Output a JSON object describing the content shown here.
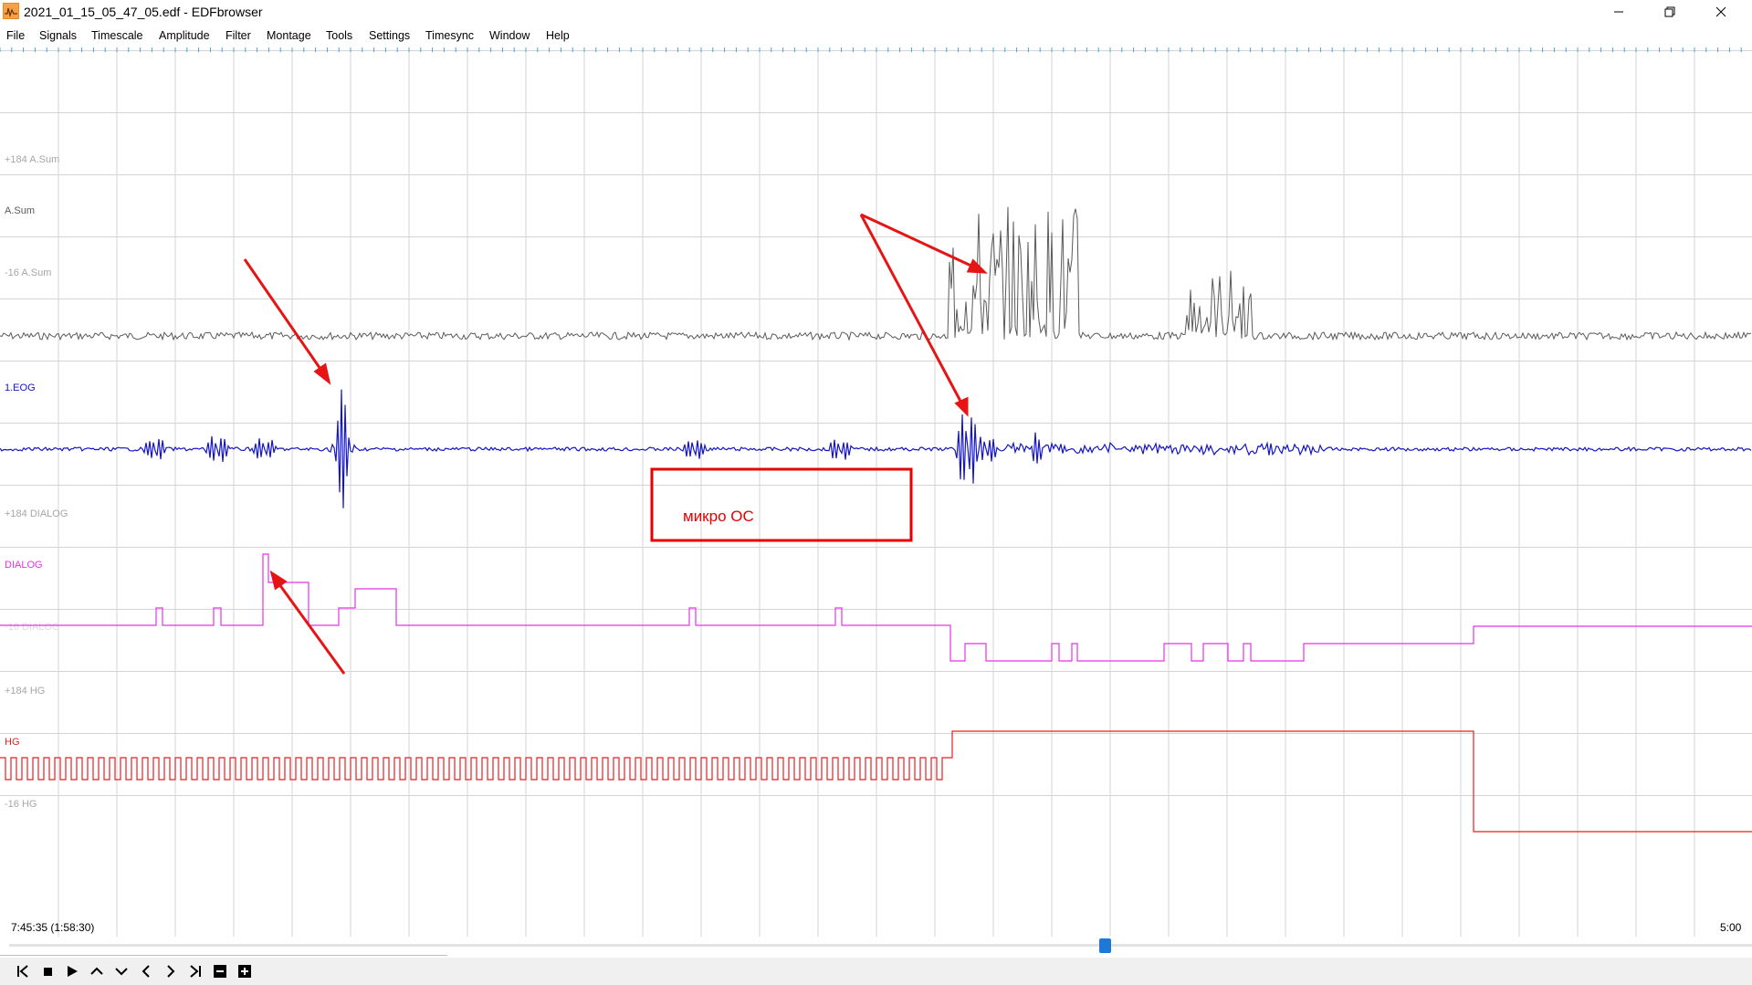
{
  "window": {
    "title": "2021_01_15_05_47_05.edf - EDFbrowser",
    "controls": [
      "minimize-icon",
      "restore-icon",
      "close-icon"
    ]
  },
  "menu": [
    {
      "label": "File",
      "key": "F"
    },
    {
      "label": "Signals",
      "key": "S"
    },
    {
      "label": "Timescale",
      "key": "T"
    },
    {
      "label": "Amplitude",
      "key": "A"
    },
    {
      "label": "Filter",
      "key": "F"
    },
    {
      "label": "Montage",
      "key": "M"
    },
    {
      "label": "Tools",
      "key": "o"
    },
    {
      "label": "Settings",
      "key": "S"
    },
    {
      "label": "Timesync",
      "key": "T"
    },
    {
      "label": "Window",
      "key": "W"
    },
    {
      "label": "Help",
      "key": "H"
    }
  ],
  "signals": [
    {
      "name": "A.Sum",
      "upper": "+184 A.Sum",
      "lower": "-16 A.Sum",
      "color": "#5a5a5a"
    },
    {
      "name": "1.EOG",
      "upper": "",
      "lower": "",
      "color": "#1414c8"
    },
    {
      "name": "DIALOG",
      "upper": "+184 DIALOG",
      "lower": "-16 DIALOG",
      "color": "#e632e6"
    },
    {
      "name": "HG",
      "upper": "+184 HG",
      "lower": "-16 HG",
      "color": "#e61e1e"
    }
  ],
  "annotation": {
    "label": "микро ОС",
    "color": "#e60000"
  },
  "timeline": {
    "start": "7:45:35 (1:58:30)",
    "end": "5:00",
    "scroll_position": 0.63
  },
  "toolbar": [
    "skip-start-icon",
    "stop-icon",
    "play-icon",
    "scroll-up-icon",
    "scroll-down-icon",
    "prev-page-icon",
    "next-page-icon",
    "skip-end-icon",
    "zoom-out-icon",
    "zoom-in-icon"
  ],
  "colors": {
    "grid": "#d4d4d4",
    "label": "#a6a6a6",
    "arrow": "#e61414"
  }
}
